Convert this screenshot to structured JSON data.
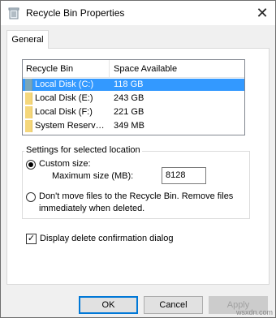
{
  "window": {
    "title": "Recycle Bin Properties",
    "close_glyph": "✕"
  },
  "tabs": [
    {
      "label": "General"
    }
  ],
  "listview": {
    "columns": [
      "Recycle Bin Location",
      "Space Available"
    ],
    "rows": [
      {
        "name": "Local Disk (C:)",
        "space": "118 GB",
        "selected": true
      },
      {
        "name": "Local Disk (E:)",
        "space": "243 GB",
        "selected": false
      },
      {
        "name": "Local Disk (F:)",
        "space": "221 GB",
        "selected": false
      },
      {
        "name": "System Reserv…",
        "space": "349 MB",
        "selected": false
      }
    ]
  },
  "settings": {
    "group_title": "Settings for selected location",
    "custom_size_label": "Custom size:",
    "custom_size_checked": true,
    "max_size_label": "Maximum size (MB):",
    "max_size_value": "8128",
    "dont_move_line1": "Don't move files to the Recycle Bin. Remove files",
    "dont_move_line2": "immediately when deleted.",
    "dont_move_checked": false
  },
  "confirm": {
    "label": "Display delete confirmation dialog",
    "checked": true,
    "check_glyph": "✓"
  },
  "buttons": {
    "ok": "OK",
    "cancel": "Cancel",
    "apply": "Apply"
  },
  "watermark": "wsxdn.com",
  "colors": {
    "selection": "#3399ff",
    "default_button_border": "#0078d7",
    "folder_icon": "#f5d77b"
  }
}
